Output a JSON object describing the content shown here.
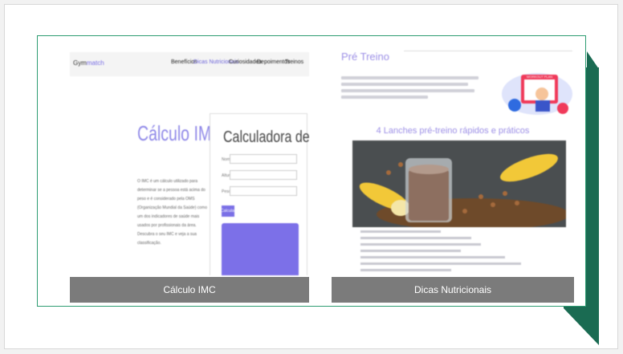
{
  "cards": [
    {
      "caption": "Cálculo IMC",
      "site": {
        "brand_prefix": "Gym",
        "brand_suffix": "match",
        "nav": [
          "Benefícios",
          "Dicas Nutricionais",
          "Curiosidades",
          "Depoimentos",
          "Treinos"
        ],
        "active_nav": "Dicas Nutricionais",
        "heading": "Cálculo IMC",
        "body_text": "O IMC é um cálculo utilizado para determinar se a pessoa está acima do peso e é considerado pela OMS (Organização Mundial da Saúde) como um dos indicadores de saúde mais usados por profissionais da área. Descubra o seu IMC e veja a sua classificação.",
        "calculator": {
          "title": "Calculadora de IMC",
          "field_labels": [
            "Nome",
            "Altura",
            "Peso"
          ],
          "button_label": "Calcular"
        }
      }
    },
    {
      "caption": "Dicas Nutricionais",
      "site": {
        "heading": "Pré Treino",
        "subheading": "4 Lanches pré-treino rápidos e práticos",
        "illustration_label": "WORKOUT PLAN"
      }
    }
  ],
  "colors": {
    "accent_green": "#1a6b52",
    "card_border": "#2e9c72",
    "caption_bg": "#7b7b7b",
    "brand_purple": "#7a6fe6"
  }
}
